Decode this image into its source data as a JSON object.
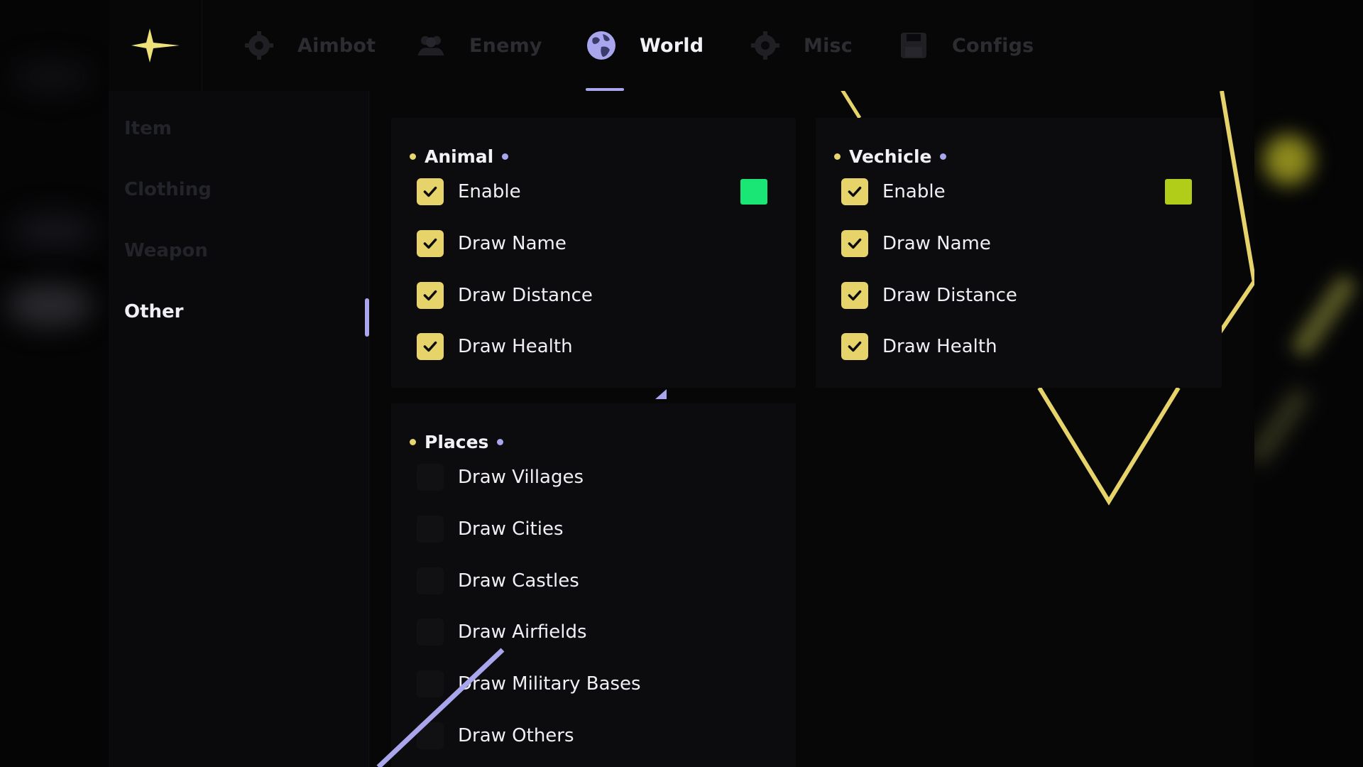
{
  "colors": {
    "accent_yellow": "#e6d36a",
    "accent_purple": "#a9a6ee",
    "animal_swatch": "#19e675",
    "vehicle_swatch": "#b2cd19"
  },
  "tabs": [
    {
      "label": "Aimbot",
      "icon": "gear-icon",
      "active": false
    },
    {
      "label": "Enemy",
      "icon": "users-icon",
      "active": false
    },
    {
      "label": "World",
      "icon": "globe-icon",
      "active": true
    },
    {
      "label": "Misc",
      "icon": "gear-icon",
      "active": false
    },
    {
      "label": "Configs",
      "icon": "save-icon",
      "active": false
    }
  ],
  "sidebar": {
    "items": [
      {
        "label": "Item",
        "active": false
      },
      {
        "label": "Clothing",
        "active": false
      },
      {
        "label": "Weapon",
        "active": false
      },
      {
        "label": "Other",
        "active": true
      }
    ]
  },
  "animal": {
    "title": "Animal",
    "options": [
      {
        "label": "Enable",
        "checked": true
      },
      {
        "label": "Draw Name",
        "checked": true
      },
      {
        "label": "Draw Distance",
        "checked": true
      },
      {
        "label": "Draw Health",
        "checked": true
      }
    ]
  },
  "vehicle": {
    "title": "Vechicle",
    "options": [
      {
        "label": "Enable",
        "checked": true
      },
      {
        "label": "Draw Name",
        "checked": true
      },
      {
        "label": "Draw Distance",
        "checked": true
      },
      {
        "label": "Draw Health",
        "checked": true
      }
    ]
  },
  "places": {
    "title": "Places",
    "options": [
      {
        "label": "Draw Villages",
        "checked": false
      },
      {
        "label": "Draw Cities",
        "checked": false
      },
      {
        "label": "Draw Castles",
        "checked": false
      },
      {
        "label": "Draw Airfields",
        "checked": false
      },
      {
        "label": "Draw Military Bases",
        "checked": false
      },
      {
        "label": "Draw Others",
        "checked": false
      }
    ]
  }
}
